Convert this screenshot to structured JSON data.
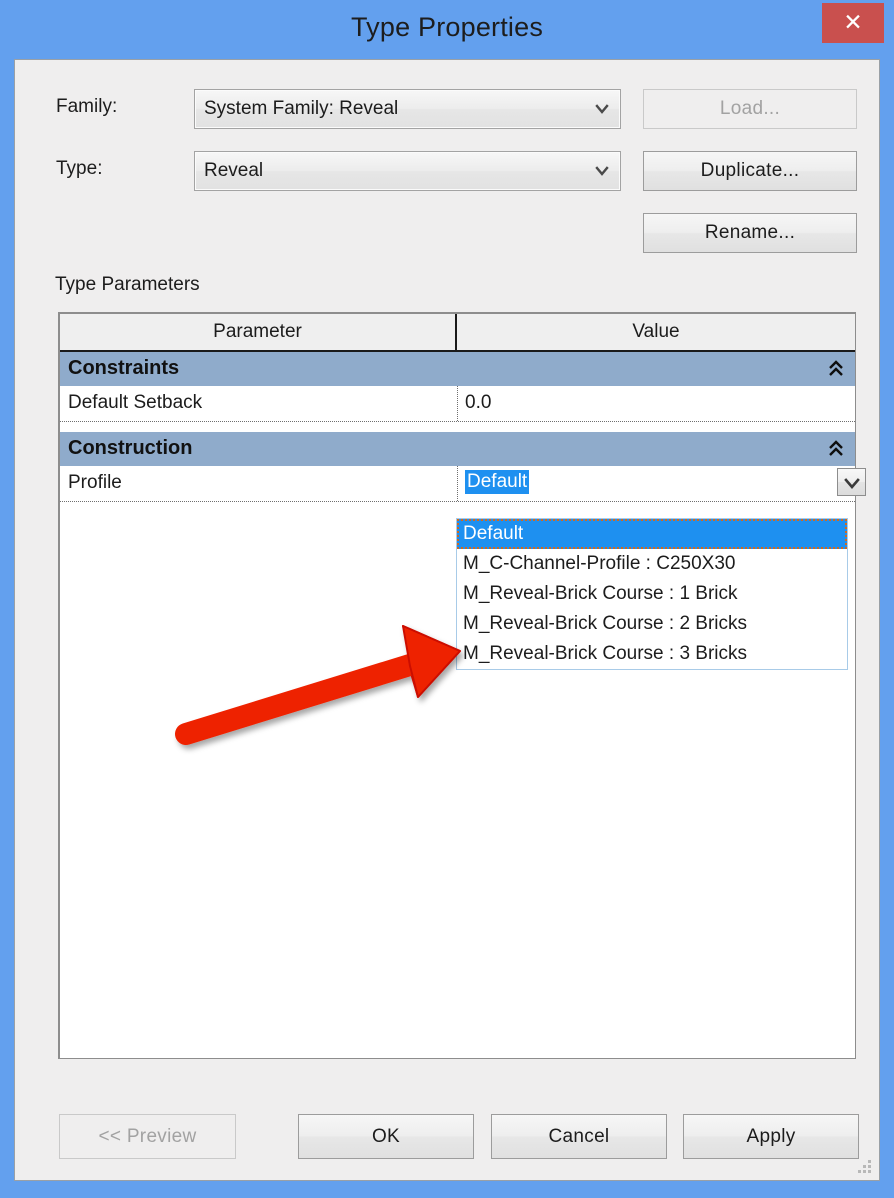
{
  "window": {
    "title": "Type Properties",
    "close_label": "✕",
    "accent_titlebar": "#63a0ee",
    "close_button_color": "#c9504e"
  },
  "form": {
    "family_label": "Family:",
    "family_value": "System Family: Reveal",
    "type_label": "Type:",
    "type_value": "Reveal",
    "load_button": "Load...",
    "duplicate_button": "Duplicate...",
    "rename_button": "Rename..."
  },
  "parameters": {
    "section_label": "Type Parameters",
    "columns": [
      "Parameter",
      "Value"
    ],
    "groups": [
      {
        "name": "Constraints",
        "rows": [
          {
            "parameter": "Default Setback",
            "value": "0.0",
            "selected": false
          }
        ]
      },
      {
        "name": "Construction",
        "rows": [
          {
            "parameter": "Profile",
            "value": "Default",
            "selected": true
          }
        ]
      }
    ]
  },
  "dropdown": {
    "open": true,
    "selected": "Default",
    "options": [
      "Default",
      "M_C-Channel-Profile : C250X30",
      "M_Reveal-Brick Course : 1 Brick",
      "M_Reveal-Brick Course : 2 Bricks",
      "M_Reveal-Brick Course : 3 Bricks"
    ],
    "highlight_color": "#1e90f0"
  },
  "footer": {
    "preview_button": "<< Preview",
    "ok_button": "OK",
    "cancel_button": "Cancel",
    "apply_button": "Apply"
  },
  "annotation": {
    "arrow_color": "#ee2200",
    "points_to": "M_Reveal-Brick Course : 3 Bricks"
  }
}
